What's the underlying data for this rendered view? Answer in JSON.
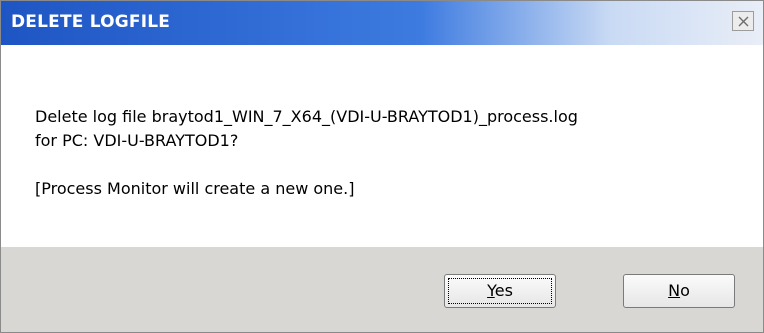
{
  "window": {
    "title": "DELETE LOGFILE"
  },
  "message": {
    "line1": "Delete log file braytod1_WIN_7_X64_(VDI-U-BRAYTOD1)_process.log",
    "line2": "for PC: VDI-U-BRAYTOD1?",
    "line3": "[Process Monitor will create a new one.]"
  },
  "buttons": {
    "yes_accel": "Y",
    "yes_rest": "es",
    "no_accel": "N",
    "no_rest": "o"
  },
  "icons": {
    "close": "close-icon"
  },
  "colors": {
    "titlebar_start": "#1e55c4",
    "titlebar_end": "#e9eef7",
    "footer_bg": "#d9d7d3"
  }
}
